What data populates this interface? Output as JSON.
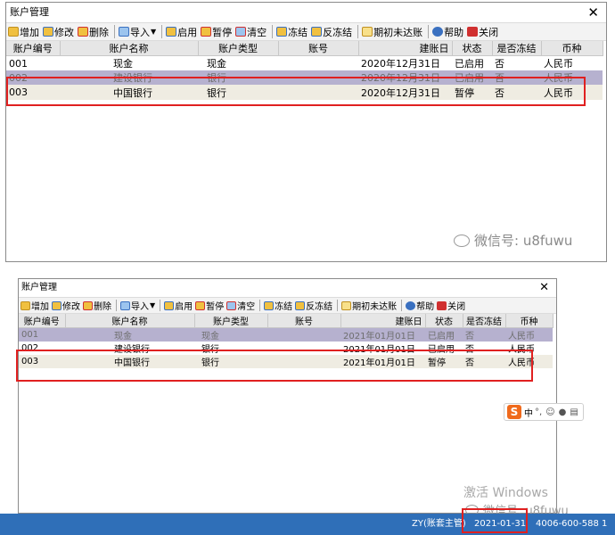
{
  "window_title": "账户管理",
  "close_glyph": "✕",
  "toolbar": {
    "add": "增加",
    "edit": "修改",
    "delete": "删除",
    "import": "导入",
    "enable": "启用",
    "pause": "暂停",
    "clear": "清空",
    "freeze": "冻结",
    "unfreeze": "反冻结",
    "period_close": "期初未达账",
    "help": "帮助",
    "close": "关闭"
  },
  "columns": [
    "账户编号",
    "账户名称",
    "账户类型",
    "账号",
    "建账日",
    "状态",
    "是否冻结",
    "币种"
  ],
  "top_rows": [
    [
      "001",
      "现金",
      "现金",
      "",
      "2020年12月31日",
      "已启用",
      "否",
      "人民币"
    ],
    [
      "002",
      "建设银行",
      "银行",
      "",
      "2020年12月31日",
      "已启用",
      "否",
      "人民币"
    ],
    [
      "003",
      "中国银行",
      "银行",
      "",
      "2020年12月31日",
      "暂停",
      "否",
      "人民币"
    ]
  ],
  "bottom_rows": [
    [
      "001",
      "现金",
      "现金",
      "",
      "2021年01月01日",
      "已启用",
      "否",
      "人民币"
    ],
    [
      "002",
      "建设银行",
      "银行",
      "",
      "2021年01月01日",
      "已启用",
      "否",
      "人民币"
    ],
    [
      "003",
      "中国银行",
      "银行",
      "",
      "2021年01月01日",
      "暂停",
      "否",
      "人民币"
    ]
  ],
  "watermark": "微信号: u8fuwu",
  "watermark_bottom": "微信号: u8fuwu",
  "windows_activation": "激活 Windows",
  "ime": {
    "label": "中",
    "extra": "°,"
  },
  "taskbar": {
    "user": "ZY(账套主管)",
    "date": "2021-01-31",
    "phone": "4006-600-588 1"
  },
  "colors": {
    "selected_row": "#b6b1cf",
    "highlight_box": "#e02020",
    "taskbar": "#2f6fb8"
  }
}
